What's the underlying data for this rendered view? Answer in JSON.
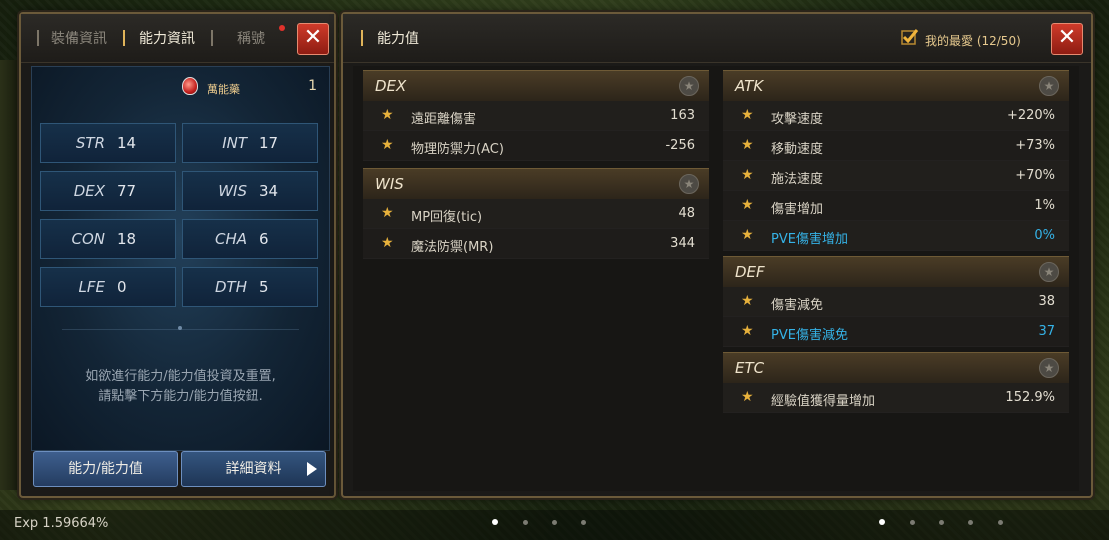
{
  "left_panel": {
    "tabs": [
      {
        "label": "裝備資訊"
      },
      {
        "label": "能力資訊"
      },
      {
        "label": "稱號"
      }
    ],
    "potion": {
      "label": "萬能藥",
      "count": "1"
    },
    "stats": [
      {
        "name": "STR",
        "value": "14"
      },
      {
        "name": "INT",
        "value": "17"
      },
      {
        "name": "DEX",
        "value": "77"
      },
      {
        "name": "WIS",
        "value": "34"
      },
      {
        "name": "CON",
        "value": "18"
      },
      {
        "name": "CHA",
        "value": "6"
      },
      {
        "name": "LFE",
        "value": "0"
      },
      {
        "name": "DTH",
        "value": "5"
      }
    ],
    "hint_line1": "如欲進行能力/能力值投資及重置,",
    "hint_line2": "請點擊下方能力/能力值按鈕.",
    "btn_ability": "能力/能力值",
    "btn_detail": "詳細資料"
  },
  "right_panel": {
    "title": "能力值",
    "favorites": "我的最愛 (12/50)",
    "groups": {
      "dex": {
        "title": "DEX",
        "rows": [
          {
            "label": "遠距離傷害",
            "value": "163"
          },
          {
            "label": "物理防禦力(AC)",
            "value": "-256"
          }
        ]
      },
      "wis": {
        "title": "WIS",
        "rows": [
          {
            "label": "MP回復(tic)",
            "value": "48"
          },
          {
            "label": "魔法防禦(MR)",
            "value": "344"
          }
        ]
      },
      "atk": {
        "title": "ATK",
        "rows": [
          {
            "label": "攻擊速度",
            "value": "+220%"
          },
          {
            "label": "移動速度",
            "value": "+73%"
          },
          {
            "label": "施法速度",
            "value": "+70%"
          },
          {
            "label": "傷害增加",
            "value": "1%"
          },
          {
            "label": "PVE傷害增加",
            "value": "0%"
          }
        ]
      },
      "def": {
        "title": "DEF",
        "rows": [
          {
            "label": "傷害減免",
            "value": "38"
          },
          {
            "label": "PVE傷害減免",
            "value": "37"
          }
        ]
      },
      "etc": {
        "title": "ETC",
        "rows": [
          {
            "label": "經驗值獲得量增加",
            "value": "152.9%"
          }
        ]
      }
    }
  },
  "hud": {
    "exp": "Exp 1.59664%"
  },
  "colors": {
    "accent_gold": "#e7b13c",
    "pve_blue": "#35b2e6",
    "close_red": "#cf3b2a"
  }
}
